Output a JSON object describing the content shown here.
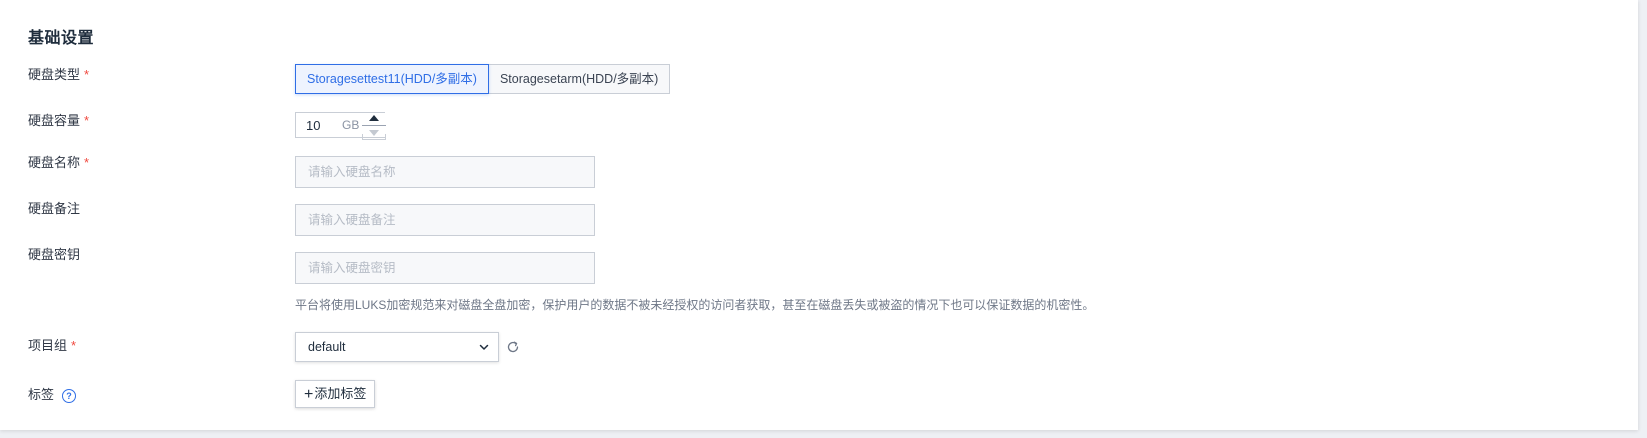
{
  "section": {
    "title": "基础设置"
  },
  "required_mark": "*",
  "disk_type": {
    "label": "硬盘类型",
    "options": [
      "Storagesettest11(HDD/多副本)",
      "Storagesetarm(HDD/多副本)"
    ],
    "selected": "Storagesettest11(HDD/多副本)"
  },
  "disk_capacity": {
    "label": "硬盘容量",
    "value": "10",
    "unit": "GB"
  },
  "disk_name": {
    "label": "硬盘名称",
    "placeholder": "请输入硬盘名称"
  },
  "disk_remark": {
    "label": "硬盘备注",
    "placeholder": "请输入硬盘备注"
  },
  "disk_key": {
    "label": "硬盘密钥",
    "placeholder": "请输入硬盘密钥",
    "hint": "平台将使用LUKS加密规范来对磁盘全盘加密，保护用户的数据不被未经授权的访问者获取，甚至在磁盘丢失或被盗的情况下也可以保证数据的机密性。"
  },
  "project_group": {
    "label": "项目组",
    "value": "default",
    "refresh_icon": "refresh-icon"
  },
  "tags": {
    "label": "标签",
    "help_icon_glyph": "?",
    "add_plus": "+",
    "add_label": "添加标签"
  },
  "colors": {
    "accent": "#2f6ee6",
    "required": "#f0483e"
  }
}
